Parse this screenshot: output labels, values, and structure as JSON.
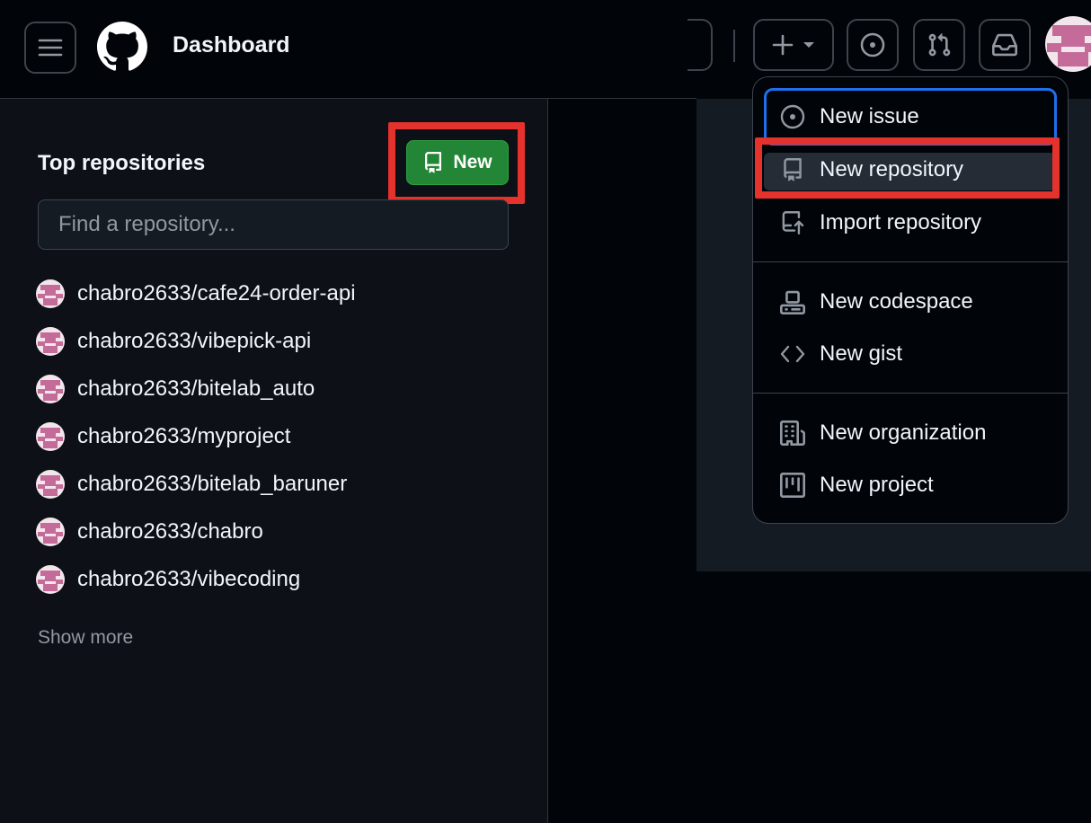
{
  "header": {
    "title": "Dashboard",
    "icons": {
      "menu": "hamburger-menu-icon",
      "logo": "github-logo-icon",
      "create": "plus-icon",
      "create_caret": "caret-down-icon",
      "issues": "issue-opened-icon",
      "pull_requests": "git-pull-request-icon",
      "inbox": "inbox-icon",
      "avatar": "user-avatar"
    }
  },
  "sidebar": {
    "title": "Top repositories",
    "new_button_label": "New",
    "search_placeholder": "Find a repository...",
    "repositories": [
      "chabro2633/cafe24-order-api",
      "chabro2633/vibepick-api",
      "chabro2633/bitelab_auto",
      "chabro2633/myproject",
      "chabro2633/bitelab_baruner",
      "chabro2633/chabro",
      "chabro2633/vibecoding"
    ],
    "show_more": "Show more"
  },
  "create_menu": {
    "items": [
      {
        "label": "New issue",
        "icon": "issue-opened-icon"
      },
      {
        "label": "New repository",
        "icon": "repo-icon"
      },
      {
        "label": "Import repository",
        "icon": "repo-push-icon"
      },
      {
        "label": "New codespace",
        "icon": "codespaces-icon"
      },
      {
        "label": "New gist",
        "icon": "code-icon"
      },
      {
        "label": "New organization",
        "icon": "organization-icon"
      },
      {
        "label": "New project",
        "icon": "project-icon"
      }
    ]
  },
  "colors": {
    "accent_green": "#238636",
    "highlight_red": "#e5322d",
    "focus_blue": "#1f6feb",
    "avatar_pink": "#c46b99"
  }
}
